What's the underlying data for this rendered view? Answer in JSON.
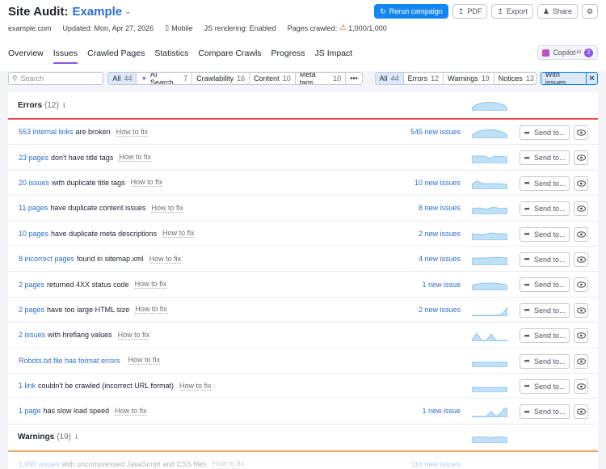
{
  "header": {
    "title": "Site Audit:",
    "project": "Example",
    "buttons": {
      "rerun": "Rerun campaign",
      "pdf": "PDF",
      "export": "Export",
      "share": "Share"
    },
    "meta": {
      "domain": "example.com",
      "updated": "Updated: Mon, Apr 27, 2026",
      "device": "Mobile",
      "js_rendering": "JS rendering: Enabled",
      "pages_crawled_label": "Pages crawled:",
      "pages_crawled_value": "1,000/1,000"
    },
    "tabs": [
      "Overview",
      "Issues",
      "Crawled Pages",
      "Statistics",
      "Compare Crawls",
      "Progress",
      "JS Impact"
    ],
    "active_tab": "Issues",
    "copilot": {
      "label": "Copilot",
      "sup": "AI",
      "count": "2"
    }
  },
  "filters": {
    "search_placeholder": "Search",
    "categories": [
      {
        "label": "All",
        "count": "44",
        "active": true
      },
      {
        "label": "AI Search",
        "count": "7"
      },
      {
        "label": "Crawlability",
        "count": "16"
      },
      {
        "label": "Content",
        "count": "10"
      },
      {
        "label": "Meta tags",
        "count": "10"
      },
      {
        "label": "•••",
        "count": ""
      }
    ],
    "severities": [
      {
        "label": "All",
        "count": "44",
        "active": true
      },
      {
        "label": "Errors",
        "count": "12"
      },
      {
        "label": "Warnings",
        "count": "19"
      },
      {
        "label": "Notices",
        "count": "13"
      }
    ],
    "with_issues": "With issues"
  },
  "errors": {
    "label": "Errors",
    "count": "(12)",
    "how_to_fix": "How to fix",
    "send_label": "Send to...",
    "rows": [
      {
        "link": "553 internal links",
        "text": "are broken",
        "new": "545 new issues",
        "trend": "hill"
      },
      {
        "link": "23 pages",
        "text": "don't have title tags",
        "new": "",
        "trend": "flatdip"
      },
      {
        "link": "20 issues",
        "text": "with duplicate title tags",
        "new": "10 new issues",
        "trend": "bumpflat"
      },
      {
        "link": "11 pages",
        "text": "have duplicate content issues",
        "new": "8 new issues",
        "trend": "wavy"
      },
      {
        "link": "10 pages",
        "text": "have duplicate meta descriptions",
        "new": "2 new issues",
        "trend": "flatwave"
      },
      {
        "link": "8 incorrect pages",
        "text": "found in sitemap.xml",
        "new": "4 new issues",
        "trend": "flathigh"
      },
      {
        "link": "2 pages",
        "text": "returned 4XX status code",
        "new": "1 new issue",
        "trend": "lowhill"
      },
      {
        "link": "2 pages",
        "text": "have too large HTML size",
        "new": "2 new issues",
        "trend": "rise"
      },
      {
        "link": "2 issues",
        "text": "with hreflang values",
        "new": "",
        "trend": "peaks"
      },
      {
        "link": "Robots.txt file has format errors",
        "text": "",
        "new": "",
        "trend": "flatlow"
      },
      {
        "link": "1 link",
        "text": "couldn't be crawled (incorrect URL format)",
        "new": "",
        "trend": "flatlow"
      },
      {
        "link": "1 page",
        "text": "has slow load speed",
        "new": "1 new issue",
        "trend": "spikes"
      }
    ]
  },
  "warnings": {
    "label": "Warnings",
    "count": "(19)",
    "first_row": {
      "link": "1,090 issues",
      "text": "with uncompressed JavaScript and CSS files",
      "new": "116 new issues"
    }
  }
}
